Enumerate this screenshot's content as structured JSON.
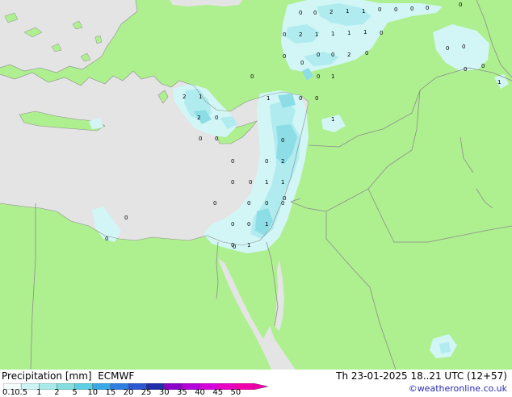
{
  "legend": {
    "title": "Precipitation [mm]",
    "model": "ECMWF",
    "ticks": [
      "0.1",
      "0.5",
      "1",
      "2",
      "5",
      "10",
      "15",
      "20",
      "25",
      "30",
      "35",
      "40",
      "45",
      "50"
    ],
    "colors": [
      "#f4fbfb",
      "#cdf4f4",
      "#a8eaea",
      "#84dede",
      "#5ccfe4",
      "#3aa8e8",
      "#2f7ee0",
      "#2b57d0",
      "#1f2ea8",
      "#8b00c8",
      "#b400d8",
      "#d600dc",
      "#e800c4",
      "#f000a8"
    ]
  },
  "valid_time": "Th 23-01-2025 18..21 UTC (12+57)",
  "credit": "©weatheronline.co.uk",
  "map_colors": {
    "land": "#aef090",
    "sea": "#e4e4e4",
    "precip_light": "#d2f6f6",
    "precip_mid": "#b0ecef",
    "precip_strong": "#8cdde6",
    "border": "#8c8c8c"
  },
  "values": [
    "0",
    "0",
    "2",
    "1",
    "1",
    "0",
    "0",
    "0",
    "0",
    "0",
    "2",
    "1",
    "1",
    "1",
    "1",
    "0",
    "0",
    "0",
    "0",
    "2",
    "0",
    "0",
    "0",
    "0",
    "0",
    "0",
    "0",
    "1",
    "0",
    "2",
    "1",
    "1",
    "0",
    "2",
    "0",
    "1",
    "0",
    "0",
    "0",
    "0",
    "0",
    "2",
    "0",
    "0",
    "1",
    "1",
    "0",
    "0",
    "0",
    "0",
    "0",
    "0",
    "1",
    "0",
    "0",
    "0",
    "1",
    "0",
    "0",
    "1",
    "0",
    "0"
  ]
}
